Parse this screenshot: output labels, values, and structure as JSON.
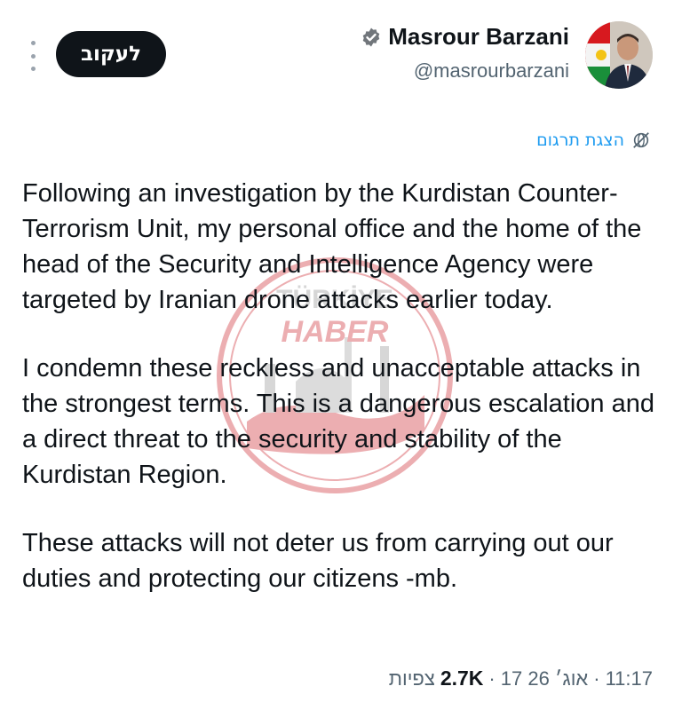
{
  "header": {
    "more_label": "⋮",
    "follow_label": "לעקוב",
    "display_name": "Masrour Barzani",
    "handle": "@masrourbarzani",
    "verified_color": "#71767b"
  },
  "translate": {
    "label": "הצגת תרגום",
    "icon": "globe-strike-icon"
  },
  "tweet": {
    "paragraphs": [
      "Following an investigation by the Kurdistan Counter-Terrorism Unit, my personal office and the home of the head of the Security and Intelligence Agency were targeted by Iranian drone attacks earlier today.",
      "I condemn these reckless and unacceptable attacks in the strongest terms. This is a dangerous escalation and a direct threat to the security and stability of the Kurdistan Region.",
      "These attacks will not deter us from carrying out our duties and protecting our citizens -mb."
    ]
  },
  "watermark": {
    "line1": "TÜRKİYE",
    "line2": "HABER"
  },
  "meta": {
    "time": "11:17",
    "date": "17 אוג׳ 26",
    "views_count": "2.7K",
    "views_label": "צפיות"
  },
  "colors": {
    "accent": "#1d9bf0",
    "text": "#0f1419",
    "muted": "#536471",
    "button_bg": "#0f1419"
  }
}
